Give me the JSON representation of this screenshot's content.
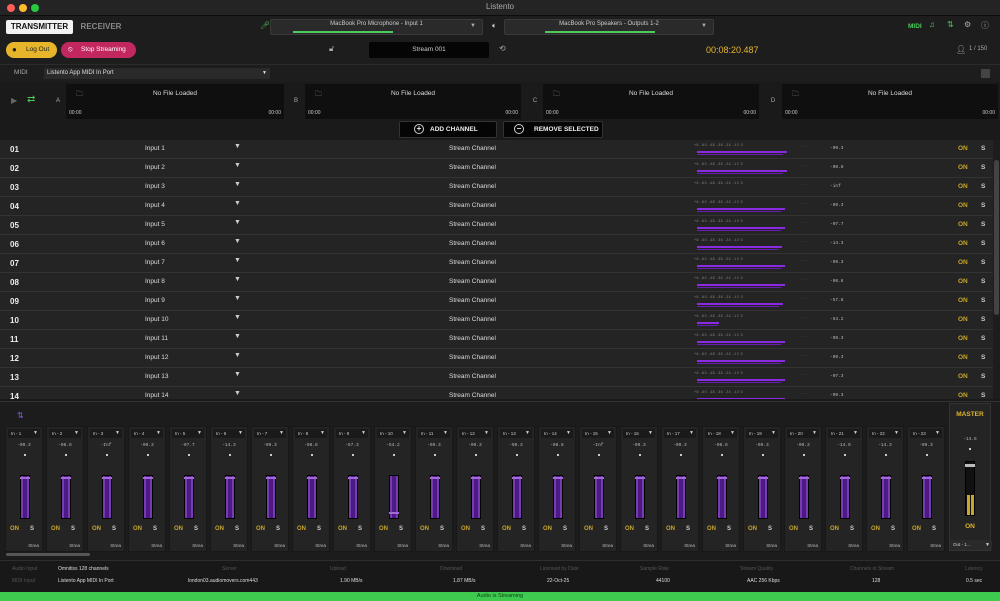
{
  "app": {
    "title": "Listento"
  },
  "tabs": [
    "TRANSMITTER",
    "RECEIVER"
  ],
  "devices": {
    "input": "MacBook Pro Microphone - Input 1",
    "output": "MacBook Pro Speakers - Outputs 1-2"
  },
  "toolbar": {
    "midi_label": "MIDI",
    "log_out": "Log Out",
    "stop_streaming": "Stop Streaming",
    "stream_name": "Stream 001",
    "timer": "00:08:20.487",
    "user_count": "1 / 150"
  },
  "midi": {
    "label": "MIDI",
    "port": "Listento App MIDI In Port"
  },
  "players": [
    {
      "label": "A",
      "file": "No File Loaded",
      "start": "00:00",
      "end": "00:00"
    },
    {
      "label": "B",
      "file": "No File Loaded",
      "start": "00:00",
      "end": "00:00"
    },
    {
      "label": "C",
      "file": "No File Loaded",
      "start": "00:00",
      "end": "00:00"
    },
    {
      "label": "D",
      "file": "No File Loaded",
      "start": "00:00",
      "end": "00:00"
    }
  ],
  "actions": {
    "add": "ADD CHANNEL",
    "remove": "REMOVE SELECTED"
  },
  "meter_ticks": "+6   -60   -48   -36   -24   -12    0",
  "channels": [
    {
      "num": "01",
      "input": "Input 1",
      "type": "Stream Channel",
      "level": 0.98,
      "value": "-09.3",
      "on": "ON",
      "solo": "S"
    },
    {
      "num": "02",
      "input": "Input 2",
      "type": "Stream Channel",
      "level": 0.98,
      "value": "-08.8",
      "on": "ON",
      "solo": "S"
    },
    {
      "num": "03",
      "input": "Input 3",
      "type": "Stream Channel",
      "level": 0,
      "value": "-inf",
      "on": "ON",
      "solo": "S"
    },
    {
      "num": "04",
      "input": "Input 4",
      "type": "Stream Channel",
      "level": 0.96,
      "value": "-09.3",
      "on": "ON",
      "solo": "S"
    },
    {
      "num": "05",
      "input": "Input 5",
      "type": "Stream Channel",
      "level": 0.96,
      "value": "-07.7",
      "on": "ON",
      "solo": "S"
    },
    {
      "num": "06",
      "input": "Input 6",
      "type": "Stream Channel",
      "level": 0.92,
      "value": "-14.3",
      "on": "ON",
      "solo": "S"
    },
    {
      "num": "07",
      "input": "Input 7",
      "type": "Stream Channel",
      "level": 0.96,
      "value": "-09.3",
      "on": "ON",
      "solo": "S"
    },
    {
      "num": "08",
      "input": "Input 8",
      "type": "Stream Channel",
      "level": 0.96,
      "value": "-08.8",
      "on": "ON",
      "solo": "S"
    },
    {
      "num": "09",
      "input": "Input 9",
      "type": "Stream Channel",
      "level": 0.93,
      "value": "-57.8",
      "on": "ON",
      "solo": "S"
    },
    {
      "num": "10",
      "input": "Input 10",
      "type": "Stream Channel",
      "level": 0.24,
      "value": "-54.2",
      "on": "ON",
      "solo": "S"
    },
    {
      "num": "11",
      "input": "Input 11",
      "type": "Stream Channel",
      "level": 0.96,
      "value": "-09.3",
      "on": "ON",
      "solo": "S"
    },
    {
      "num": "12",
      "input": "Input 12",
      "type": "Stream Channel",
      "level": 0.96,
      "value": "-09.3",
      "on": "ON",
      "solo": "S"
    },
    {
      "num": "13",
      "input": "Input 13",
      "type": "Stream Channel",
      "level": 0.96,
      "value": "-07.3",
      "on": "ON",
      "solo": "S"
    },
    {
      "num": "14",
      "input": "Input 14",
      "type": "Stream Channel",
      "level": 0.96,
      "value": "-09.3",
      "on": "ON",
      "solo": "S"
    }
  ],
  "strips": [
    {
      "sel": "In - 1",
      "value": "-09.3",
      "on": "ON",
      "solo": "S",
      "name": "Strea"
    },
    {
      "sel": "In - 2",
      "value": "-08.8",
      "on": "ON",
      "solo": "S",
      "name": "Strea"
    },
    {
      "sel": "In - 3",
      "value": "-Inf",
      "on": "ON",
      "solo": "S",
      "name": "Strea"
    },
    {
      "sel": "In - 4",
      "value": "-09.3",
      "on": "ON",
      "solo": "S",
      "name": "Strea"
    },
    {
      "sel": "In - 5",
      "value": "-07.7",
      "on": "ON",
      "solo": "S",
      "name": "Strea"
    },
    {
      "sel": "In - 6",
      "value": "-14.3",
      "on": "ON",
      "solo": "S",
      "name": "Strea"
    },
    {
      "sel": "In - 7",
      "value": "-09.3",
      "on": "ON",
      "solo": "S",
      "name": "Strea"
    },
    {
      "sel": "In - 8",
      "value": "-08.8",
      "on": "ON",
      "solo": "S",
      "name": "Strea"
    },
    {
      "sel": "In - 9",
      "value": "-57.3",
      "on": "ON",
      "solo": "S",
      "name": "Strea"
    },
    {
      "sel": "In - 10",
      "value": "-54.2",
      "on": "ON",
      "solo": "S",
      "name": "Strea"
    },
    {
      "sel": "In - 11",
      "value": "-09.3",
      "on": "ON",
      "solo": "S",
      "name": "Strea"
    },
    {
      "sel": "In - 12",
      "value": "-09.3",
      "on": "ON",
      "solo": "S",
      "name": "Strea"
    },
    {
      "sel": "In - 13",
      "value": "-09.3",
      "on": "ON",
      "solo": "S",
      "name": "Strea"
    },
    {
      "sel": "In - 14",
      "value": "-08.8",
      "on": "ON",
      "solo": "S",
      "name": "Strea"
    },
    {
      "sel": "In - 15",
      "value": "-Inf",
      "on": "ON",
      "solo": "S",
      "name": "Strea"
    },
    {
      "sel": "In - 16",
      "value": "-09.3",
      "on": "ON",
      "solo": "S",
      "name": "Strea"
    },
    {
      "sel": "In - 17",
      "value": "-09.3",
      "on": "ON",
      "solo": "S",
      "name": "Strea"
    },
    {
      "sel": "In - 18",
      "value": "-08.8",
      "on": "ON",
      "solo": "S",
      "name": "Strea"
    },
    {
      "sel": "In - 19",
      "value": "-09.3",
      "on": "ON",
      "solo": "S",
      "name": "Strea"
    },
    {
      "sel": "In - 20",
      "value": "-09.3",
      "on": "ON",
      "solo": "S",
      "name": "Strea"
    },
    {
      "sel": "In - 21",
      "value": "-14.9",
      "on": "ON",
      "solo": "S",
      "name": "Strea"
    },
    {
      "sel": "In - 22",
      "value": "-14.3",
      "on": "ON",
      "solo": "S",
      "name": "Strea"
    },
    {
      "sel": "In - 23",
      "value": "-09.3",
      "on": "ON",
      "solo": "S",
      "name": "Strea"
    }
  ],
  "master": {
    "label": "MASTER",
    "value": "-14.6",
    "on": "ON",
    "select": "Out - 1..."
  },
  "footer": {
    "headers": [
      "Audio Input",
      "Server",
      "Upload",
      "Download",
      "Licensed by Date",
      "Sample Rate",
      "Stream Quality",
      "Channels in Stream",
      "Latency"
    ],
    "row1_label": "Omnitiss 128 channels",
    "midi_label": "MIDI Input",
    "values": [
      "Listento App MIDI In Port",
      "london03.audiomovers.com443",
      "1.90 MB/s",
      "1.87 MB/s",
      "22-Oct-25",
      "44100",
      "AAC 256 Kbps",
      "128",
      "0.5 sec"
    ]
  },
  "status": "Audio is Streaming",
  "colors": {
    "accent": "#c7a62a",
    "purple": "#8a2be2",
    "green": "#3ec94f",
    "stop": "#c2285f"
  }
}
